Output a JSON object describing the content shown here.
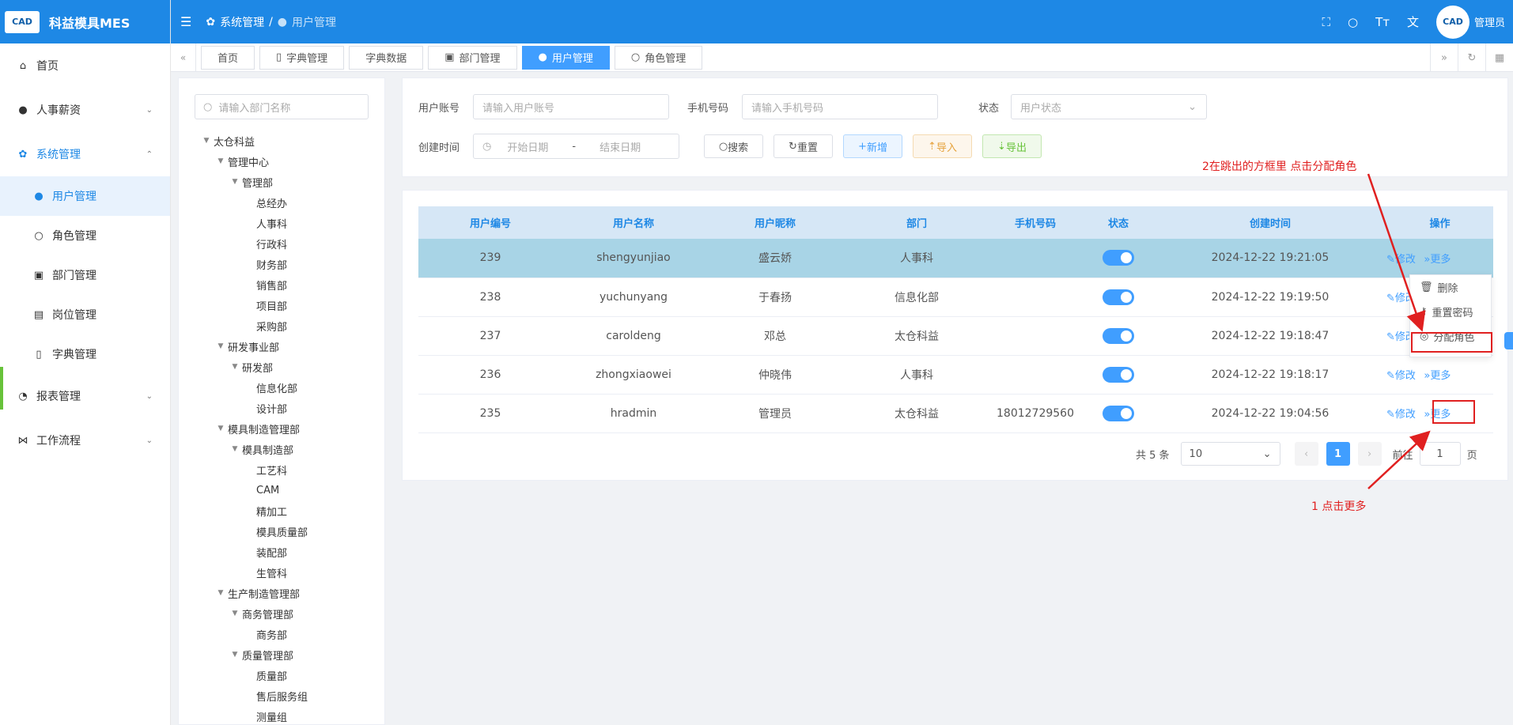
{
  "app": {
    "title": "科益模具MES",
    "logo_text": "CAD",
    "user": "管理员",
    "brand_color": "#1e88e5"
  },
  "menu": [
    {
      "icon": "home-icon",
      "label": "首页"
    },
    {
      "icon": "user-icon",
      "label": "人事薪资"
    },
    {
      "icon": "gear-icon",
      "label": "系统管理"
    },
    {
      "icon": "user-icon",
      "label": "用户管理"
    },
    {
      "icon": "person-icon",
      "label": "角色管理"
    },
    {
      "icon": "id-card-icon",
      "label": "部门管理"
    },
    {
      "icon": "badge-icon",
      "label": "岗位管理"
    },
    {
      "icon": "book-icon",
      "label": "字典管理"
    },
    {
      "icon": "chart-icon",
      "label": "报表管理"
    },
    {
      "icon": "flow-icon",
      "label": "工作流程"
    }
  ],
  "breadcrumb": {
    "parent": "系统管理",
    "current": "用户管理"
  },
  "tabs": [
    "首页",
    "字典管理",
    "字典数据",
    "部门管理",
    "用户管理",
    "角色管理"
  ],
  "tree": {
    "placeholder": "请输入部门名称",
    "nodes": [
      "太仓科益",
      "管理中心",
      "管理部",
      "总经办",
      "人事科",
      "行政科",
      "财务部",
      "销售部",
      "项目部",
      "采购部",
      "研发事业部",
      "研发部",
      "信息化部",
      "设计部",
      "模具制造管理部",
      "模具制造部",
      "工艺科",
      "CAM",
      "精加工",
      "模具质量部",
      "装配部",
      "生管科",
      "生产制造管理部",
      "商务管理部",
      "商务部",
      "质量管理部",
      "质量部",
      "售后服务组",
      "测量组"
    ]
  },
  "query": {
    "account_label": "用户账号",
    "account_ph": "请输入用户账号",
    "phone_label": "手机号码",
    "phone_ph": "请输入手机号码",
    "status_label": "状态",
    "status_ph": "用户状态",
    "time_label": "创建时间",
    "start_ph": "开始日期",
    "sep": "-",
    "end_ph": "结束日期",
    "search": "搜索",
    "reset": "重置",
    "add": "新增",
    "import": "导入",
    "export": "导出"
  },
  "table": {
    "headers": [
      "用户编号",
      "用户名称",
      "用户昵称",
      "部门",
      "手机号码",
      "状态",
      "创建时间",
      "操作"
    ],
    "rows": [
      {
        "id": "239",
        "name": "shengyunjiao",
        "nick": "盛云娇",
        "dept": "人事科",
        "phone": "",
        "time": "2024-12-22 19:21:05"
      },
      {
        "id": "238",
        "name": "yuchunyang",
        "nick": "于春扬",
        "dept": "信息化部",
        "phone": "",
        "time": "2024-12-22 19:19:50"
      },
      {
        "id": "237",
        "name": "caroldeng",
        "nick": "邓总",
        "dept": "太仓科益",
        "phone": "",
        "time": "2024-12-22 19:18:47"
      },
      {
        "id": "236",
        "name": "zhongxiaowei",
        "nick": "仲晓伟",
        "dept": "人事科",
        "phone": "",
        "time": "2024-12-22 19:18:17"
      },
      {
        "id": "235",
        "name": "hradmin",
        "nick": "管理员",
        "dept": "太仓科益",
        "phone": "18012729560",
        "time": "2024-12-22 19:04:56"
      }
    ],
    "edit": "修改",
    "more": "更多"
  },
  "pager": {
    "total": "共 5 条",
    "size": "10",
    "page": "1",
    "goto": "前往",
    "goto_val": "1",
    "unit": "页"
  },
  "dropdown": [
    "删除",
    "重置密码",
    "分配角色"
  ],
  "notes": {
    "step1": "1 点击更多",
    "step2": "2在跳出的方框里 点击分配角色"
  }
}
